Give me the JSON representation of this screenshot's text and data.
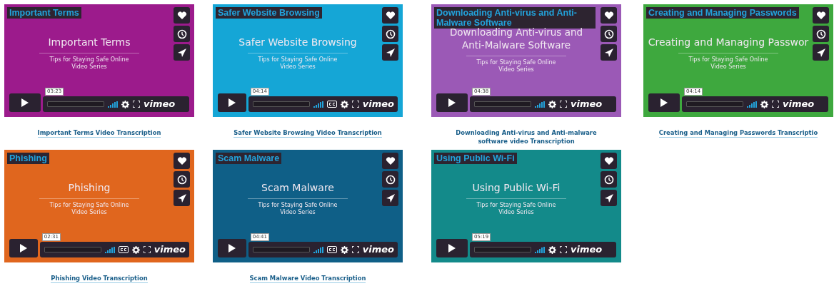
{
  "videos": [
    {
      "overlay_title": "Important Terms",
      "slide_title": "Important Terms",
      "subtitle": [
        "Tips for Staying Safe Online",
        "Video Series"
      ],
      "time": "03:23",
      "cc": false,
      "color": "#9c1b8c",
      "logo": "vimeo",
      "caption": "Important Terms Video Transcription"
    },
    {
      "overlay_title": "Safer Website Browsing",
      "slide_title": "Safer Website Browsing",
      "subtitle": [
        "Tips for Staying Safe Online",
        "Video Series"
      ],
      "time": "04:14",
      "cc": true,
      "color": "#15a6d6",
      "logo": "vimeo",
      "caption": "Safer Website Browsing Video Transcription"
    },
    {
      "overlay_title": "Downloading Anti-virus and Anti-Malware Software",
      "slide_title": "Downloading Anti-virus and\nAnti-Malware Software",
      "subtitle": [
        "Tips for Staying Safe Online",
        "Video Series"
      ],
      "time": "04:38",
      "cc": false,
      "color": "#9b59b6",
      "logo": "vimeo",
      "caption": "Downloading Anti-virus and Anti-malware software video Transcription"
    },
    {
      "overlay_title": "Creating and Managing Passwords",
      "slide_title": "Creating and Managing Passwor",
      "subtitle": [
        "Tips for Staying Safe Online",
        "Video Series"
      ],
      "time": "04:14",
      "cc": false,
      "color": "#3ea83e",
      "logo": "vimeo",
      "caption": "Creating and Managing Passwords Transcriptio"
    },
    {
      "overlay_title": "Phishing",
      "slide_title": "Phishing",
      "subtitle": [
        "Tips for Staying Safe Online",
        "Video Series"
      ],
      "time": "02:31",
      "cc": true,
      "color": "#e0661e",
      "logo": "vimeo",
      "caption": "Phishing Video Transcription"
    },
    {
      "overlay_title": "Scam Malware",
      "slide_title": "Scam Malware",
      "subtitle": [
        "Tips for Staying Safe Online",
        "Video Series"
      ],
      "time": "04:41",
      "cc": true,
      "color": "#0f5f87",
      "logo": "vimeo",
      "caption": "Scam Malware Video Transcription"
    },
    {
      "overlay_title": "Using Public Wi-Fi",
      "slide_title": "Using Public Wi-Fi",
      "subtitle": [
        "Tips for Staying Safe Online",
        "Video Series"
      ],
      "time": "05:19",
      "cc": false,
      "color": "#138a8a",
      "logo": "vimeo"
    }
  ]
}
